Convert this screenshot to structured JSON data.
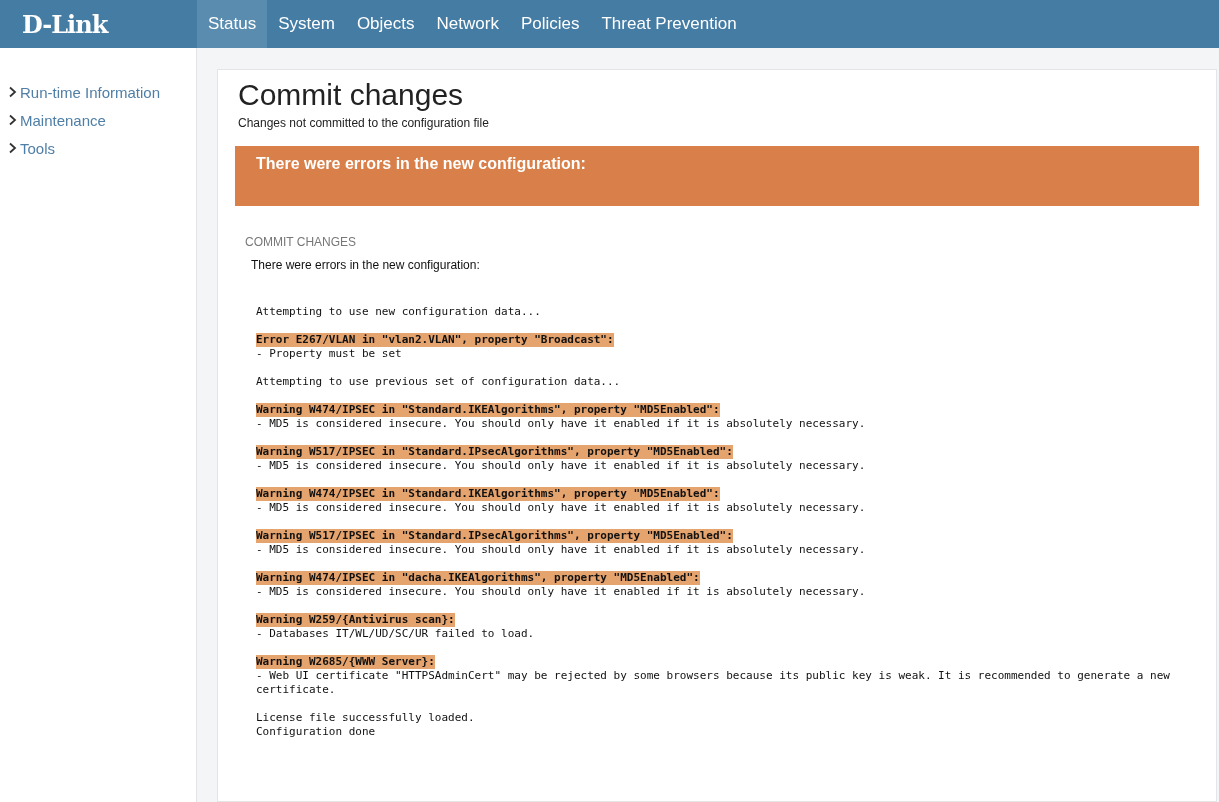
{
  "header": {
    "logo": "D-Link",
    "nav": [
      {
        "label": "Status",
        "selected": true
      },
      {
        "label": "System",
        "selected": false
      },
      {
        "label": "Objects",
        "selected": false
      },
      {
        "label": "Network",
        "selected": false
      },
      {
        "label": "Policies",
        "selected": false
      },
      {
        "label": "Threat Prevention",
        "selected": false
      }
    ]
  },
  "sidebar": {
    "items": [
      {
        "label": "Run-time Information",
        "expanded": false
      },
      {
        "label": "Maintenance",
        "expanded": false
      },
      {
        "label": "Tools",
        "expanded": false
      }
    ]
  },
  "page": {
    "title": "Commit changes",
    "subtitle": "Changes not committed to the configuration file",
    "alert": "There were errors in the new configuration:",
    "section": {
      "heading": "COMMIT CHANGES",
      "message": "There were errors in the new configuration:",
      "log": [
        {
          "lines": [
            {
              "kind": "plain",
              "text": "Attempting to use new configuration data..."
            }
          ]
        },
        {
          "lines": [
            {
              "kind": "highlight",
              "text": "Error E267/VLAN in \"vlan2.VLAN\", property \"Broadcast\":"
            },
            {
              "kind": "plain",
              "text": "- Property must be set"
            }
          ]
        },
        {
          "lines": [
            {
              "kind": "plain",
              "text": "Attempting to use previous set of configuration data..."
            }
          ]
        },
        {
          "lines": [
            {
              "kind": "highlight",
              "text": "Warning W474/IPSEC in \"Standard.IKEAlgorithms\", property \"MD5Enabled\":"
            },
            {
              "kind": "plain",
              "text": "- MD5 is considered insecure. You should only have it enabled if it is absolutely necessary."
            }
          ]
        },
        {
          "lines": [
            {
              "kind": "highlight",
              "text": "Warning W517/IPSEC in \"Standard.IPsecAlgorithms\", property \"MD5Enabled\":"
            },
            {
              "kind": "plain",
              "text": "- MD5 is considered insecure. You should only have it enabled if it is absolutely necessary."
            }
          ]
        },
        {
          "lines": [
            {
              "kind": "highlight",
              "text": "Warning W474/IPSEC in \"Standard.IKEAlgorithms\", property \"MD5Enabled\":"
            },
            {
              "kind": "plain",
              "text": "- MD5 is considered insecure. You should only have it enabled if it is absolutely necessary."
            }
          ]
        },
        {
          "lines": [
            {
              "kind": "highlight",
              "text": "Warning W517/IPSEC in \"Standard.IPsecAlgorithms\", property \"MD5Enabled\":"
            },
            {
              "kind": "plain",
              "text": "- MD5 is considered insecure. You should only have it enabled if it is absolutely necessary."
            }
          ]
        },
        {
          "lines": [
            {
              "kind": "highlight",
              "text": "Warning W474/IPSEC in \"dacha.IKEAlgorithms\", property \"MD5Enabled\":"
            },
            {
              "kind": "plain",
              "text": "- MD5 is considered insecure. You should only have it enabled if it is absolutely necessary."
            }
          ]
        },
        {
          "lines": [
            {
              "kind": "highlight",
              "text": "Warning W259/{Antivirus scan}:"
            },
            {
              "kind": "plain",
              "text": "- Databases IT/WL/UD/SC/UR failed to load."
            }
          ]
        },
        {
          "lines": [
            {
              "kind": "highlight",
              "text": "Warning W2685/{WWW Server}:"
            },
            {
              "kind": "plain",
              "text": "- Web UI certificate \"HTTPSAdminCert\" may be rejected by some browsers because its public key is weak. It is recommended to generate a new certificate."
            }
          ]
        },
        {
          "lines": [
            {
              "kind": "plain",
              "text": "License file successfully loaded."
            },
            {
              "kind": "plain",
              "text": "Configuration done"
            }
          ]
        }
      ]
    }
  }
}
